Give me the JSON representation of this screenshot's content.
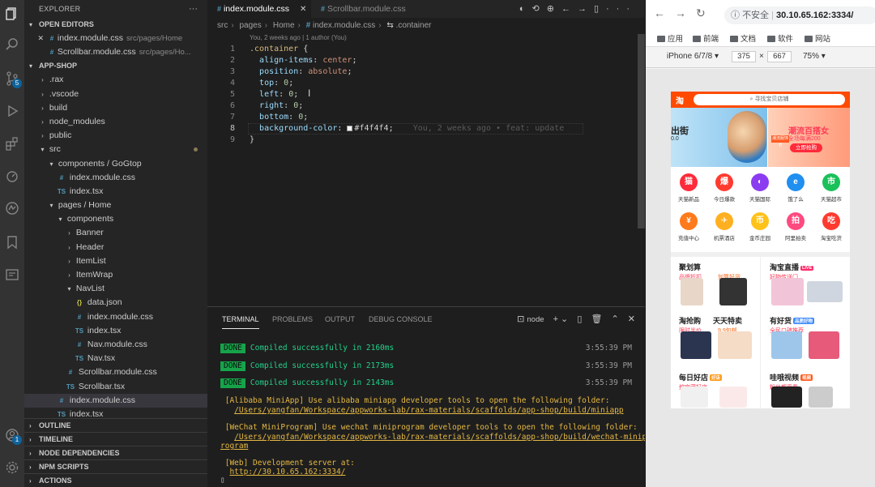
{
  "sidebar": {
    "title": "EXPLORER",
    "open_editors": "OPEN EDITORS",
    "open_files": [
      {
        "name": "index.module.css",
        "path": "src/pages/Home"
      },
      {
        "name": "Scrollbar.module.css",
        "path": "src/pages/Ho..."
      }
    ],
    "project": "APP-SHOP",
    "tree": [
      {
        "label": ".rax",
        "type": "folder",
        "depth": 1,
        "open": false
      },
      {
        "label": ".vscode",
        "type": "folder",
        "depth": 1,
        "open": false
      },
      {
        "label": "build",
        "type": "folder",
        "depth": 1,
        "open": false
      },
      {
        "label": "node_modules",
        "type": "folder",
        "depth": 1,
        "open": false
      },
      {
        "label": "public",
        "type": "folder",
        "depth": 1,
        "open": false
      },
      {
        "label": "src",
        "type": "folder",
        "depth": 1,
        "open": true,
        "modified": true
      },
      {
        "label": "components / GoGtop",
        "type": "folder",
        "depth": 2,
        "open": true
      },
      {
        "label": "index.module.css",
        "type": "css",
        "depth": 3
      },
      {
        "label": "index.tsx",
        "type": "ts",
        "depth": 3
      },
      {
        "label": "pages / Home",
        "type": "folder",
        "depth": 2,
        "open": true
      },
      {
        "label": "components",
        "type": "folder",
        "depth": 3,
        "open": true
      },
      {
        "label": "Banner",
        "type": "folder",
        "depth": 4,
        "open": false
      },
      {
        "label": "Header",
        "type": "folder",
        "depth": 4,
        "open": false
      },
      {
        "label": "ItemList",
        "type": "folder",
        "depth": 4,
        "open": false
      },
      {
        "label": "ItemWrap",
        "type": "folder",
        "depth": 4,
        "open": false
      },
      {
        "label": "NavList",
        "type": "folder",
        "depth": 4,
        "open": true
      },
      {
        "label": "data.json",
        "type": "json",
        "depth": 5
      },
      {
        "label": "index.module.css",
        "type": "css",
        "depth": 5
      },
      {
        "label": "index.tsx",
        "type": "ts",
        "depth": 5
      },
      {
        "label": "Nav.module.css",
        "type": "css",
        "depth": 5
      },
      {
        "label": "Nav.tsx",
        "type": "ts",
        "depth": 5
      },
      {
        "label": "Scrollbar.module.css",
        "type": "css",
        "depth": 4
      },
      {
        "label": "Scrollbar.tsx",
        "type": "ts",
        "depth": 4
      },
      {
        "label": "index.module.css",
        "type": "css",
        "depth": 3,
        "selected": true
      },
      {
        "label": "index.tsx",
        "type": "ts",
        "depth": 3
      }
    ],
    "bottom_sections": [
      "OUTLINE",
      "TIMELINE",
      "NODE DEPENDENCIES",
      "NPM SCRIPTS",
      "ACTIONS"
    ]
  },
  "activity": {
    "source_control_badge": "5",
    "account_badge": "1"
  },
  "editor": {
    "tabs": [
      {
        "label": "index.module.css",
        "active": true
      },
      {
        "label": "Scrollbar.module.css",
        "active": false
      }
    ],
    "breadcrumbs": [
      "src",
      "pages",
      "Home",
      "index.module.css",
      ".container"
    ],
    "blame": "You, 2 weeks ago | 1 author (You)",
    "lines": [
      {
        "n": "1",
        "selector": ".container",
        "brace": " {"
      },
      {
        "n": "2",
        "prop": "align-items",
        "value": "center"
      },
      {
        "n": "3",
        "prop": "position",
        "value": "absolute"
      },
      {
        "n": "4",
        "prop": "top",
        "value": "0"
      },
      {
        "n": "5",
        "prop": "left",
        "value": "0"
      },
      {
        "n": "6",
        "prop": "right",
        "value": "0"
      },
      {
        "n": "7",
        "prop": "bottom",
        "value": "0"
      },
      {
        "n": "8",
        "prop": "background-color",
        "value": "#f4f4f4"
      },
      {
        "n": "9",
        "close": "}"
      }
    ],
    "gitlens": "You, 2 weeks ago • feat: update",
    "current_line": "8"
  },
  "panel": {
    "tabs": [
      "TERMINAL",
      "PROBLEMS",
      "OUTPUT",
      "DEBUG CONSOLE"
    ],
    "shell": "node",
    "compiled": [
      {
        "badge": "DONE",
        "text": "Compiled successfully in 2160ms",
        "time": "3:55:39 PM"
      },
      {
        "badge": "DONE",
        "text": "Compiled successfully in 2173ms",
        "time": "3:55:39 PM"
      },
      {
        "badge": "DONE",
        "text": "Compiled successfully in 2143ms",
        "time": "3:55:39 PM"
      }
    ],
    "alibaba": "[Alibaba MiniApp] Use alibaba miniapp developer tools to open the following folder:",
    "alibaba_path": "/Users/yangfan/Workspace/appworks-lab/rax-materials/scaffolds/app-shop/build/miniapp",
    "wechat": "[WeChat MiniProgram] Use wechat miniprogram developer tools to open the following folder:",
    "wechat_path1": "/Users/yangfan/Workspace/appworks-lab/rax-materials/scaffolds/app-shop/build/wechat-minip",
    "wechat_path2": "rogram",
    "web": "[Web] Development server at:",
    "web_url": "http://30.10.65.162:3334/"
  },
  "browser": {
    "insecure": "不安全",
    "url": "30.10.65.162:3334/",
    "bookmarks": [
      "应用",
      "前端",
      "文档",
      "软件",
      "网站"
    ],
    "device": "iPhone 6/7/8",
    "width": "375",
    "height": "667",
    "zoom": "75%"
  },
  "phone": {
    "logo": "淘",
    "search_placeholder": "寻找宝贝店铺",
    "banner_left_title": "出街",
    "banner_left_sub": "0.0",
    "banner_right_title": "潮流百搭女",
    "banner_right_sub": "全场每满200",
    "banner_btn": "立即抢购",
    "banner_tag": "潮流服饰节",
    "nav": [
      {
        "label": "天猫新品",
        "color": "#ff2a3a",
        "glyph": "猫"
      },
      {
        "label": "今日爆款",
        "color": "#ff3b30",
        "glyph": "爆"
      },
      {
        "label": "天猫国际",
        "color": "#8b3cf0",
        "glyph": "◐"
      },
      {
        "label": "饿了么",
        "color": "#1f8ff0",
        "glyph": "e"
      },
      {
        "label": "天猫超市",
        "color": "#1ac15a",
        "glyph": "市"
      },
      {
        "label": "充值中心",
        "color": "#ff7a1a",
        "glyph": "¥"
      },
      {
        "label": "机票酒店",
        "color": "#ffb020",
        "glyph": "✈"
      },
      {
        "label": "金币庄园",
        "color": "#ffc21a",
        "glyph": "币"
      },
      {
        "label": "阿里拍卖",
        "color": "#ff4a80",
        "glyph": "拍"
      },
      {
        "label": "淘宝吃货",
        "color": "#ff3b30",
        "glyph": "吃"
      }
    ],
    "feeds": [
      {
        "title": "聚划算",
        "sub1": "品牌折扣",
        "sub2": "划算好货",
        "tag": ""
      },
      {
        "title": "淘宝直播",
        "sub1": "好物传送门",
        "sub2": "",
        "tag": "LIVE"
      },
      {
        "title": "淘抢购",
        "sub1": "限时半价",
        "sub2": "9.9包邮",
        "tag": ""
      },
      {
        "title": "天天特卖",
        "sub1": "",
        "sub2": "",
        "tag": ""
      },
      {
        "title": "有好货",
        "sub1": "全民口碑推荐",
        "sub2": "",
        "tag": "品质好物"
      },
      {
        "title": "每日好店",
        "sub1": "挖宝藏好店",
        "sub2": "",
        "tag": "好店"
      },
      {
        "title": "哇哦视频",
        "sub1": "粉丝都爱看",
        "sub2": "",
        "tag": "视频"
      }
    ]
  }
}
